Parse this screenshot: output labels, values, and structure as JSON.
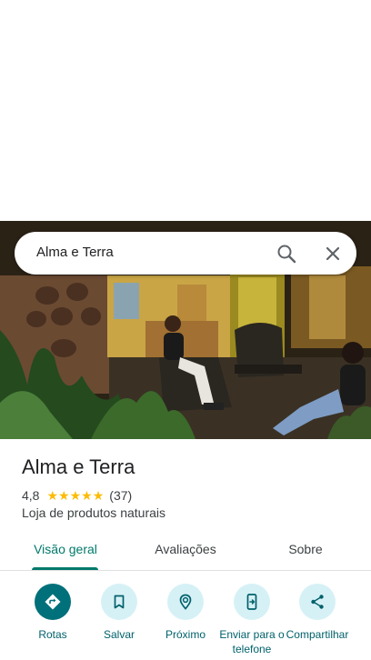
{
  "search": {
    "query": "Alma e Terra"
  },
  "place": {
    "name": "Alma e Terra",
    "rating": "4,8",
    "stars": 4.8,
    "reviews_count": "(37)",
    "category": "Loja de produtos naturais"
  },
  "tabs": [
    {
      "label": "Visão geral",
      "active": true
    },
    {
      "label": "Avaliações",
      "active": false
    },
    {
      "label": "Sobre",
      "active": false
    }
  ],
  "actions": [
    {
      "label": "Rotas",
      "icon": "directions-icon"
    },
    {
      "label": "Salvar",
      "icon": "bookmark-icon"
    },
    {
      "label": "Próximo",
      "icon": "nearby-icon"
    },
    {
      "label": "Enviar para o telefone",
      "icon": "send-to-phone-icon"
    },
    {
      "label": "Compartilhar",
      "icon": "share-icon"
    }
  ],
  "colors": {
    "accent": "#00796b",
    "action_primary": "#00707a",
    "action_bg": "#d6f1f6",
    "star": "#fbbc04"
  }
}
